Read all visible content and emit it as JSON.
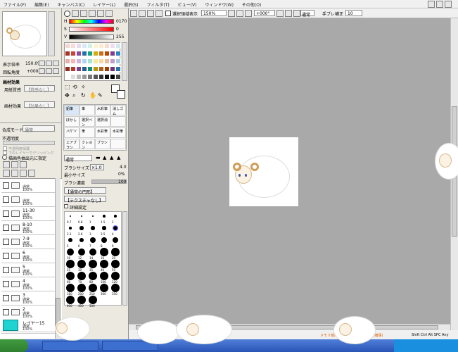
{
  "menubar": {
    "items": [
      "ファイル(F)",
      "編集(E)",
      "キャンバス(C)",
      "レイヤー(L)",
      "選択(S)",
      "フィルタ(T)",
      "ビュー(V)",
      "ウィンドウ(W)",
      "その他(O)"
    ]
  },
  "toolbar": {
    "selection_checkbox": "選択領域表示",
    "zoom": "150%",
    "rotation": "+000°",
    "blend_mode": "通常",
    "stabilizer_label": "手ブレ補正",
    "stabilizer_value": "10"
  },
  "navigator": {
    "zoom_label": "表示倍率",
    "zoom_value": "150.0%",
    "rotate_label": "回転角度",
    "rotate_value": "+000°"
  },
  "color": {
    "h_label": "H",
    "h_value": "0170",
    "s_label": "S",
    "s_value": "0",
    "v_label": "V",
    "v_value": "255"
  },
  "paper_texture": {
    "title": "画材効果",
    "paper_label": "用紙質感",
    "paper_value": "【質感なし】",
    "effect_label": "画材効果",
    "effect_value": "【効果なし】"
  },
  "layer_props": {
    "blend_label": "合成モード",
    "blend_value": "通常",
    "opacity_label": "不透明度",
    "opacity_value": "100%",
    "protect_label": "不透明度保護",
    "clip_label": "下のレイヤーでクリッピング",
    "source_label": "描画色抽出元に指定"
  },
  "layers": [
    {
      "name": "",
      "mode": "通常",
      "opacity": "100%"
    },
    {
      "name": "",
      "mode": "通常",
      "opacity": "100%"
    },
    {
      "name": "11-30",
      "mode": "通常",
      "opacity": "100%"
    },
    {
      "name": "8-10",
      "mode": "通常",
      "opacity": "100%"
    },
    {
      "name": "7-9",
      "mode": "通常",
      "opacity": "100%"
    },
    {
      "name": "6",
      "mode": "通常",
      "opacity": "100%"
    },
    {
      "name": "5",
      "mode": "通常",
      "opacity": "100%"
    },
    {
      "name": "4",
      "mode": "通常",
      "opacity": "100%"
    },
    {
      "name": "3",
      "mode": "通常",
      "opacity": "100%"
    },
    {
      "name": "2",
      "mode": "通常",
      "opacity": "100%"
    },
    {
      "name": "1",
      "mode": "通常",
      "opacity": "100%"
    },
    {
      "name": "レイヤー15",
      "mode": "通常",
      "opacity": "100%"
    }
  ],
  "tools": [
    [
      "鉛筆",
      "筆",
      "水彩筆",
      "消しゴム"
    ],
    [
      "ぼかし",
      "選択ペン",
      "選択消",
      ""
    ],
    [
      "バケツ",
      "筆",
      "水彩筆",
      "水彩筆"
    ],
    [
      "エアブラシ",
      "クレヨン",
      "ブラシ",
      ""
    ]
  ],
  "brush": {
    "mode": "通常",
    "size_label": "ブラシサイズ",
    "size_mult": "×1.0",
    "size_value": "4.0",
    "min_label": "最小サイズ",
    "min_value": "0%",
    "density_label": "ブラシ濃度",
    "density_value": "100",
    "shape_value": "【通常の円形】",
    "texture_value": "【テクスチャなし】",
    "detail_label": "詳細設定"
  },
  "brush_sizes_labels": [
    "0.7",
    "0.8",
    "1",
    "1.5",
    "2",
    "2.3",
    "2.6",
    "3",
    "3.5",
    "4",
    "5",
    "6",
    "7",
    "8",
    "9",
    "10",
    "12",
    "14",
    "16",
    "20",
    "25",
    "30",
    "35",
    "40",
    "50",
    "60",
    "70",
    "80",
    "100",
    "120",
    "160",
    "200",
    "250",
    "300",
    "350",
    "400",
    "450",
    "500"
  ],
  "status": {
    "memory": "メモリ使用量 48%(使用)/374MB(確保)",
    "keys": "Shift Ctrl Alt SPC",
    "time": "Any"
  }
}
